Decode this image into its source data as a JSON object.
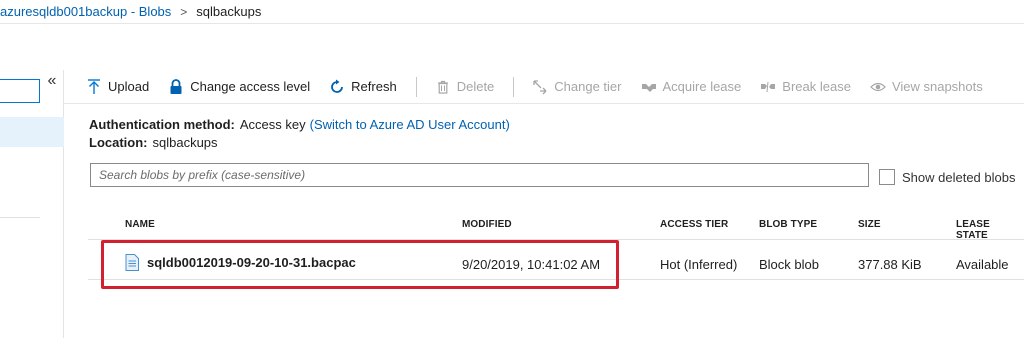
{
  "breadcrumb": {
    "parent": "azuresqldb001backup - Blobs",
    "separator": ">",
    "current": "sqlbackups"
  },
  "left_pane": {
    "collapse_glyph": "«"
  },
  "toolbar": {
    "upload": "Upload",
    "change_access": "Change access level",
    "refresh": "Refresh",
    "delete": "Delete",
    "change_tier": "Change tier",
    "acquire_lease": "Acquire lease",
    "break_lease": "Break lease",
    "view_snapshots": "View snapshots"
  },
  "info": {
    "auth_label": "Authentication method:",
    "auth_value": "Access key",
    "auth_link": "(Switch to Azure AD User Account)",
    "location_label": "Location:",
    "location_value": "sqlbackups"
  },
  "search": {
    "placeholder": "Search blobs by prefix (case-sensitive)"
  },
  "show_deleted_label": "Show deleted blobs",
  "table": {
    "columns": [
      "NAME",
      "MODIFIED",
      "ACCESS TIER",
      "BLOB TYPE",
      "SIZE",
      "LEASE STATE"
    ],
    "rows": [
      {
        "name": "sqldb0012019-09-20-10-31.bacpac",
        "modified": "9/20/2019, 10:41:02 AM",
        "access_tier": "Hot (Inferred)",
        "blob_type": "Block blob",
        "size": "377.88 KiB",
        "lease_state": "Available"
      }
    ]
  },
  "colors": {
    "accent": "#0078d4",
    "link": "#0062b0",
    "highlight_border": "#d1202f",
    "disabled": "#a6a6a6"
  }
}
